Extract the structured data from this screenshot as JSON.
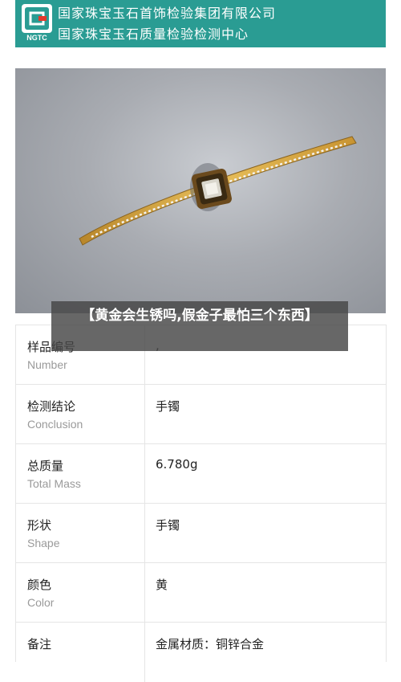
{
  "header": {
    "org_line1": "国家珠宝玉石首饰检验集团有限公司",
    "org_line2": "国家珠宝玉石质量检验检测中心",
    "logo_text": "NGTC",
    "bg_color": "#2a9c93"
  },
  "photo": {
    "alt": "bangle-photo"
  },
  "overlay": {
    "title": "【黄金会生锈吗,假金子最怕三个东西】"
  },
  "table": {
    "rows": [
      {
        "label_cn": "样品编号",
        "label_en": "Number",
        "value": ","
      },
      {
        "label_cn": "检测结论",
        "label_en": "Conclusion",
        "value": "手镯"
      },
      {
        "label_cn": "总质量",
        "label_en": "Total Mass",
        "value": "6.780g"
      },
      {
        "label_cn": "形状",
        "label_en": "Shape",
        "value": "手镯"
      },
      {
        "label_cn": "颜色",
        "label_en": "Color",
        "value": "黄"
      },
      {
        "label_cn": "备注",
        "label_en": "",
        "value": "金属材质：铜锌合金"
      }
    ]
  }
}
